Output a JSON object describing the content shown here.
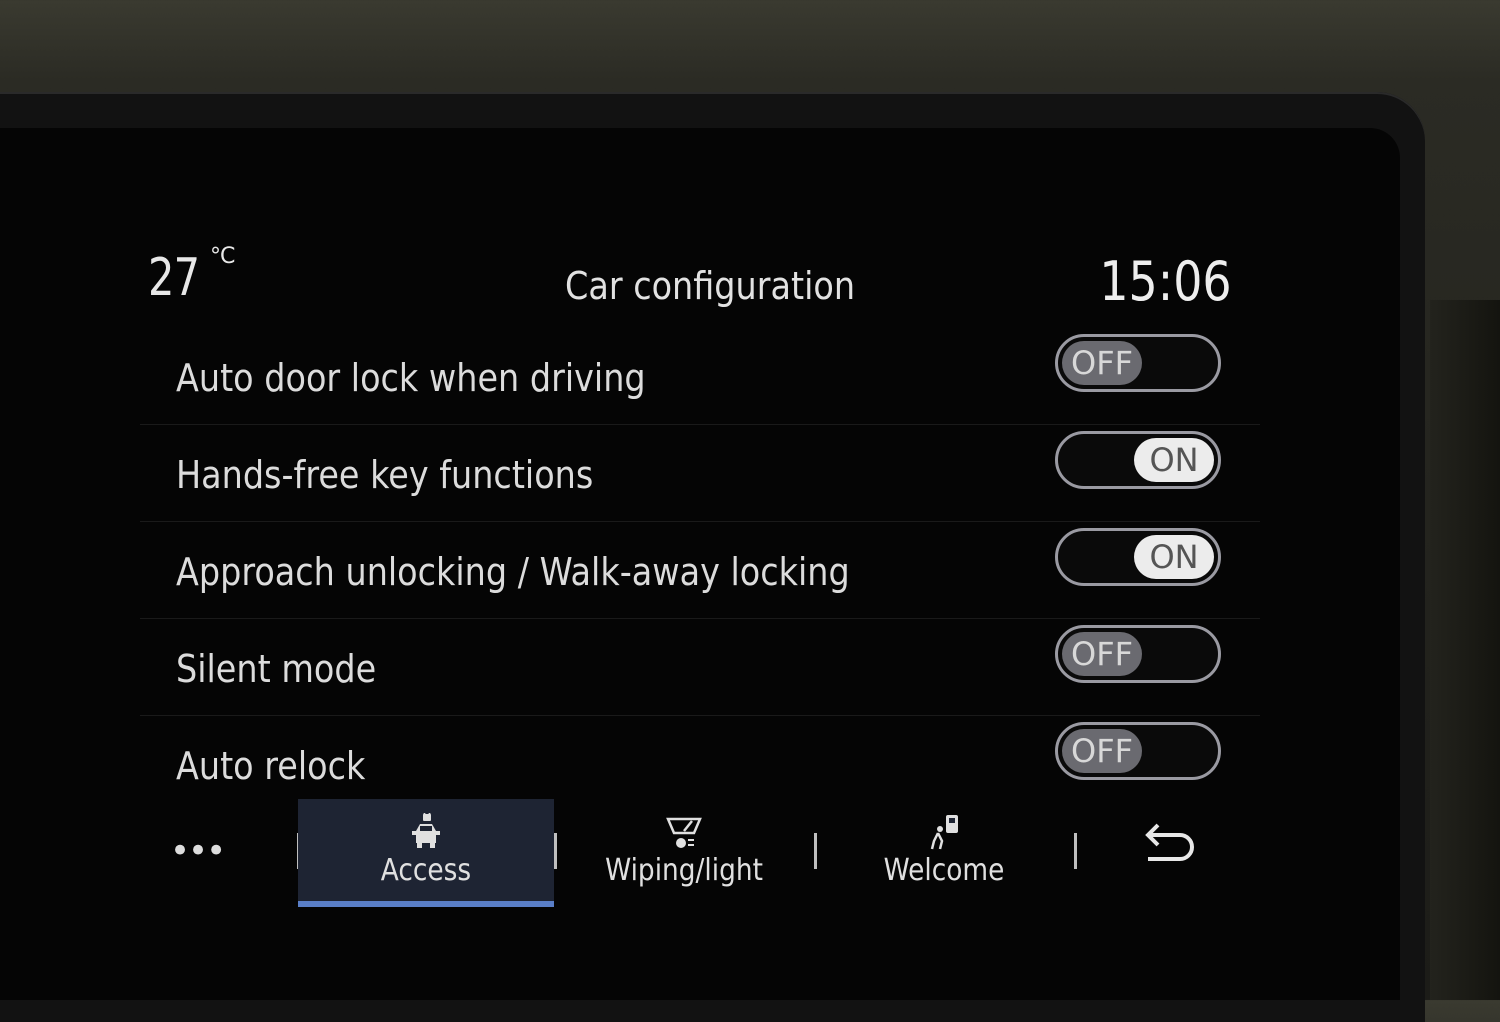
{
  "status": {
    "temperature": "27",
    "temperature_unit": "°C",
    "title": "Car configuration",
    "time": "15:06"
  },
  "settings": [
    {
      "label": "Auto door lock when driving",
      "state": "OFF"
    },
    {
      "label": "Hands-free key functions",
      "state": "ON"
    },
    {
      "label": "Approach unlocking / Walk-away locking",
      "state": "ON"
    },
    {
      "label": "Silent mode",
      "state": "OFF"
    },
    {
      "label": "Auto relock",
      "state": "OFF"
    }
  ],
  "nav": {
    "more_label": "•••",
    "tabs": [
      {
        "label": "Access",
        "icon": "car-lock-icon",
        "active": true
      },
      {
        "label": "Wiping/light",
        "icon": "wiper-light-icon",
        "active": false
      },
      {
        "label": "Welcome",
        "icon": "welcome-walk-icon",
        "active": false
      }
    ],
    "back_icon": "back-arrow-icon"
  },
  "colors": {
    "accent": "#5a7fc8",
    "active_tab_bg": "#1e2433",
    "toggle_on_knob": "#ececec",
    "toggle_off_knob": "#6a6a70"
  }
}
